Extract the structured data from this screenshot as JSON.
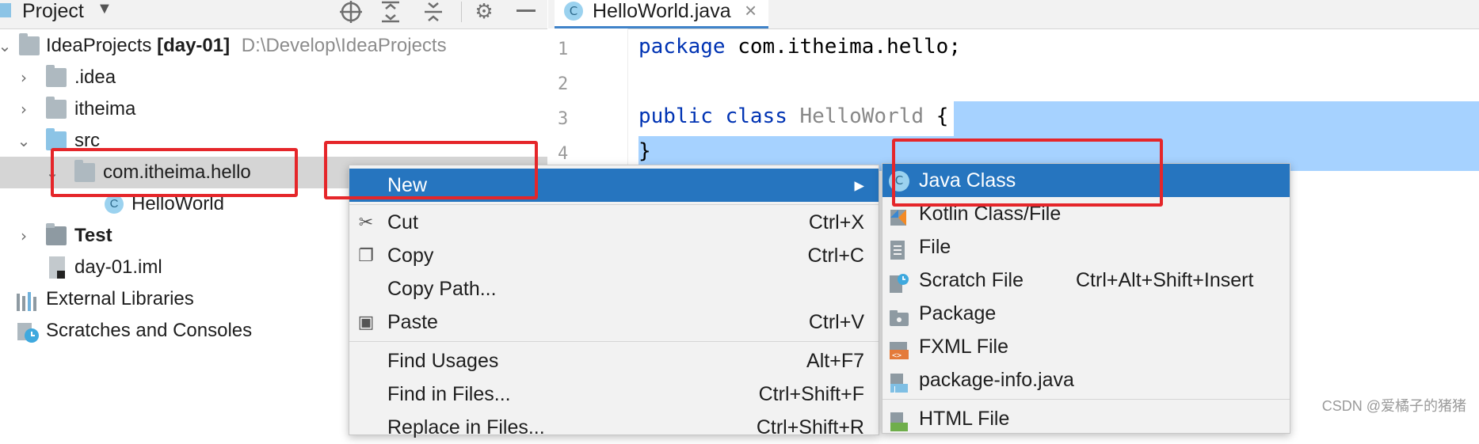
{
  "project_panel": {
    "title": "Project",
    "tree": [
      {
        "label": "IdeaProjects",
        "bold_suffix": "[day-01]",
        "path": "D:\\Develop\\IdeaProjects"
      },
      {
        "label": ".idea"
      },
      {
        "label": "itheima"
      },
      {
        "label": "src"
      },
      {
        "label": "com.itheima.hello"
      },
      {
        "label": "HelloWorld"
      },
      {
        "label": "Test"
      },
      {
        "label": "day-01.iml"
      },
      {
        "label": "External Libraries"
      },
      {
        "label": "Scratches and Consoles"
      }
    ]
  },
  "editor": {
    "tab_label": "HelloWorld.java",
    "tab_close": "×",
    "class_icon_letter": "C",
    "line_numbers": [
      "1",
      "2",
      "3",
      "4"
    ],
    "line1_kw": "package",
    "line1_rest": " com.itheima.hello;",
    "line3_kw1": "public",
    "line3_kw2": "class",
    "line3_name": "HelloWorld",
    "line3_brace": "{",
    "line4": "}"
  },
  "context_menu": {
    "items": [
      {
        "label": "New",
        "shortcut": "▸"
      },
      {
        "label": "Cut",
        "shortcut": "Ctrl+X"
      },
      {
        "label": "Copy",
        "shortcut": "Ctrl+C"
      },
      {
        "label": "Copy Path...",
        "shortcut": ""
      },
      {
        "label": "Paste",
        "shortcut": "Ctrl+V"
      },
      {
        "label": "Find Usages",
        "shortcut": "Alt+F7"
      },
      {
        "label": "Find in Files...",
        "shortcut": "Ctrl+Shift+F"
      },
      {
        "label": "Replace in Files...",
        "shortcut": "Ctrl+Shift+R"
      }
    ]
  },
  "submenu": {
    "items": [
      {
        "label": "Java Class",
        "shortcut": ""
      },
      {
        "label": "Kotlin Class/File",
        "shortcut": ""
      },
      {
        "label": "File",
        "shortcut": ""
      },
      {
        "label": "Scratch File",
        "shortcut": "Ctrl+Alt+Shift+Insert"
      },
      {
        "label": "Package",
        "shortcut": ""
      },
      {
        "label": "FXML File",
        "shortcut": ""
      },
      {
        "label": "package-info.java",
        "shortcut": ""
      },
      {
        "label": "HTML File",
        "shortcut": ""
      }
    ]
  },
  "watermark": "CSDN @爱橘子的猪猪",
  "colors": {
    "highlight": "#2675bf",
    "selection": "#a6d2ff",
    "annotation": "#e5262a"
  }
}
